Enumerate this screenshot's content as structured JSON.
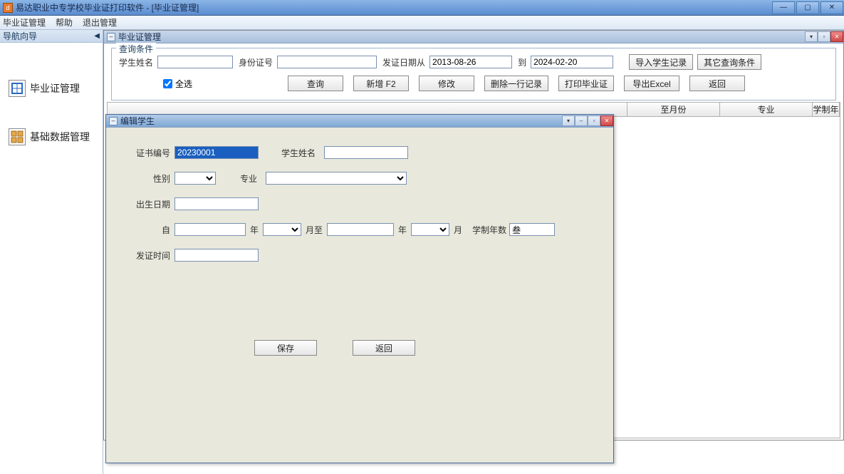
{
  "window": {
    "title": "易达职业中专学校毕业证打印软件   -  [毕业证管理]"
  },
  "menubar": {
    "item1": "毕业证管理",
    "item2": "帮助",
    "item3": "退出管理"
  },
  "sidebar": {
    "title": "导航向导",
    "items": [
      {
        "label": "毕业证管理"
      },
      {
        "label": "基础数据管理"
      }
    ]
  },
  "mdi": {
    "title": "毕业证管理",
    "groupTitle": "查询条件",
    "labels": {
      "studentName": "学生姓名",
      "idNumber": "身份证号",
      "issueDateFrom": "发证日期从",
      "to": "到",
      "selectAll": "全选"
    },
    "values": {
      "studentName": "",
      "idNumber": "",
      "dateFrom": "2013-08-26",
      "dateTo": "2024-02-20"
    },
    "buttons": {
      "importStudents": "导入学生记录",
      "otherQuery": "其它查询条件",
      "query": "查询",
      "add": "新增 F2",
      "edit": "修改",
      "deleteRow": "删除一行记录",
      "print": "打印毕业证",
      "exportExcel": "导出Excel",
      "back": "返回"
    },
    "table": {
      "cols": [
        "至月份",
        "专业",
        "学制年"
      ]
    }
  },
  "dialog": {
    "title": "编辑学生",
    "labels": {
      "certNo": "证书编号",
      "studentName": "学生姓名",
      "gender": "性别",
      "major": "专业",
      "birthDate": "出生日期",
      "from": "自",
      "year1": "年",
      "monthTo": "月至",
      "year2": "年",
      "month": "月",
      "studyYears": "学制年数",
      "issueTime": "发证时间"
    },
    "values": {
      "certNo": "20230001",
      "studentName": "",
      "gender": "",
      "major": "",
      "birthDate": "",
      "fromYear": "",
      "fromMonth": "",
      "toYear": "",
      "toMonth": "",
      "studyYears": "叁",
      "issueTime": ""
    },
    "buttons": {
      "save": "保存",
      "back": "返回"
    }
  }
}
